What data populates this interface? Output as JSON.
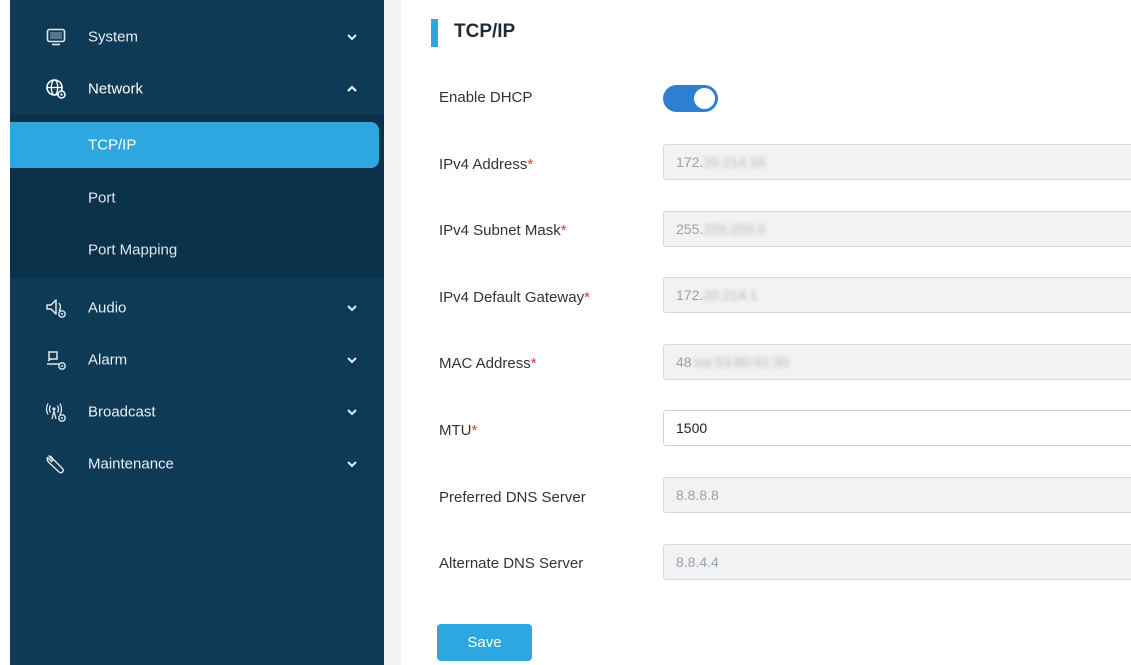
{
  "sidebar": {
    "items": [
      {
        "label": "System",
        "icon": "monitor-icon",
        "expanded": false
      },
      {
        "label": "Network",
        "icon": "globe-gear-icon",
        "expanded": true
      },
      {
        "label": "Audio",
        "icon": "speaker-gear-icon",
        "expanded": false
      },
      {
        "label": "Alarm",
        "icon": "alarm-gear-icon",
        "expanded": false
      },
      {
        "label": "Broadcast",
        "icon": "broadcast-gear-icon",
        "expanded": false
      },
      {
        "label": "Maintenance",
        "icon": "wrench-icon",
        "expanded": false
      }
    ],
    "network_sub": [
      {
        "label": "TCP/IP",
        "active": true
      },
      {
        "label": "Port",
        "active": false
      },
      {
        "label": "Port Mapping",
        "active": false
      }
    ]
  },
  "page": {
    "title": "TCP/IP",
    "required_mark": "*",
    "dhcp": {
      "label": "Enable DHCP",
      "enabled": true
    },
    "fields": {
      "ipv4_address": {
        "label": "IPv4 Address",
        "prefix": "172.",
        "rest": "20.214.16"
      },
      "subnet_mask": {
        "label": "IPv4 Subnet Mask",
        "prefix": "255.",
        "rest": "255.255.0"
      },
      "gateway": {
        "label": "IPv4 Default Gateway",
        "prefix": "172.",
        "rest": "20.214.1"
      },
      "mac": {
        "label": "MAC Address",
        "prefix": "48",
        "rest": ":ea:53:80:91:30"
      },
      "mtu": {
        "label": "MTU",
        "value": "1500"
      },
      "dns_preferred": {
        "label": "Preferred DNS Server",
        "value": "8.8.8.8"
      },
      "dns_alternate": {
        "label": "Alternate DNS Server",
        "value": "8.8.4.4"
      }
    },
    "save_label": "Save"
  },
  "colors": {
    "sidebar_bg": "#0f3a55",
    "accent": "#2ea7e0",
    "toggle_on": "#2e7fd1",
    "required": "#e5352b"
  }
}
